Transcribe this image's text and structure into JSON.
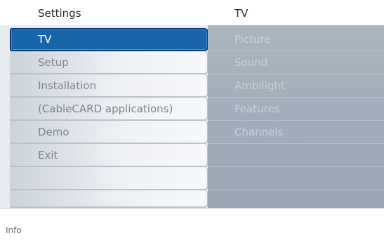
{
  "header": {
    "left_title": "Settings",
    "right_title": "TV"
  },
  "menu": {
    "items": [
      {
        "label": "TV",
        "selected": true
      },
      {
        "label": "Setup"
      },
      {
        "label": "Installation"
      },
      {
        "label": "(CableCARD applications)"
      },
      {
        "label": "Demo"
      },
      {
        "label": "Exit"
      },
      {
        "label": ""
      },
      {
        "label": ""
      }
    ]
  },
  "submenu": {
    "items": [
      {
        "label": "Picture"
      },
      {
        "label": "Sound"
      },
      {
        "label": "Ambilight"
      },
      {
        "label": "Features"
      },
      {
        "label": "Channels"
      },
      {
        "label": ""
      },
      {
        "label": ""
      },
      {
        "label": ""
      }
    ]
  },
  "info": {
    "label": "Info"
  },
  "colors": {
    "selected_bg": "#1764a8",
    "selected_border": "#0a3b6b",
    "right_panel_bg": "#a9b4bf"
  }
}
